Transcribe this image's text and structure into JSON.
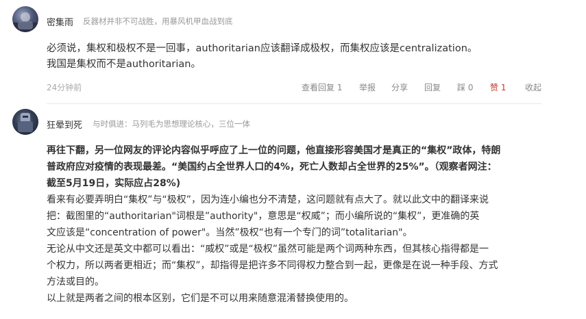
{
  "comments": [
    {
      "username": "密集雨",
      "signature": "反器材并非不可战胜，用暴风机甲血战到底",
      "lines": [
        "必须说，集权和极权不是一回事，authoritarian应该翻译成极权，而集权应该是centralization。",
        "我国是集权而不是authoritarian。"
      ],
      "time": "24分钟前",
      "actions": {
        "view_replies": "查看回复 1",
        "report": "举报",
        "share": "分享",
        "reply": "回复",
        "dislike": "踩 0",
        "like": "赞 1",
        "collapse": "收起"
      }
    },
    {
      "username": "狂晕到死",
      "signature": "与时俱进：马列毛为思想理论核心，三位一体",
      "bold_lines": [
        "再往下翻，另一位网友的评论内容似乎呼应了上一位的问题，他直接形容美国才是真正的“集权”政体，特朗",
        "普政府应对疫情的表现最差。“美国约占全世界人口的4%，死亡人数却占全世界的25%”。（观察者网注：",
        "截至5月19日，实际应占28%)"
      ],
      "lines": [
        "看来有必要弄明白“集权”与“极权”，因为连小编也分不清楚，这问题就有点大了。就以此文中的翻译来说",
        "把：截图里的“authoritarian\"词根是”authority\"，意思是“权威”；而小编所说的“集权”，更准确的英",
        "文应该是“concentration of power\"。当然”极权“也有一个专门的词”totalitarian\"。",
        "无论从中文还是英文中都可以看出：“威权”或是“极权”虽然可能是两个词两种东西，但其核心指得都是一",
        "个权力，所以两者更相近；而“集权”，却指得是把许多不同得权力整合到一起，更像是在说一种手段、方式",
        "方法或目的。",
        "以上就是两者之间的根本区别，它们是不可以用来随意混淆替换使用的。"
      ]
    }
  ],
  "colors": {
    "like": "#c0392b",
    "meta": "#999999",
    "text": "#333333"
  }
}
